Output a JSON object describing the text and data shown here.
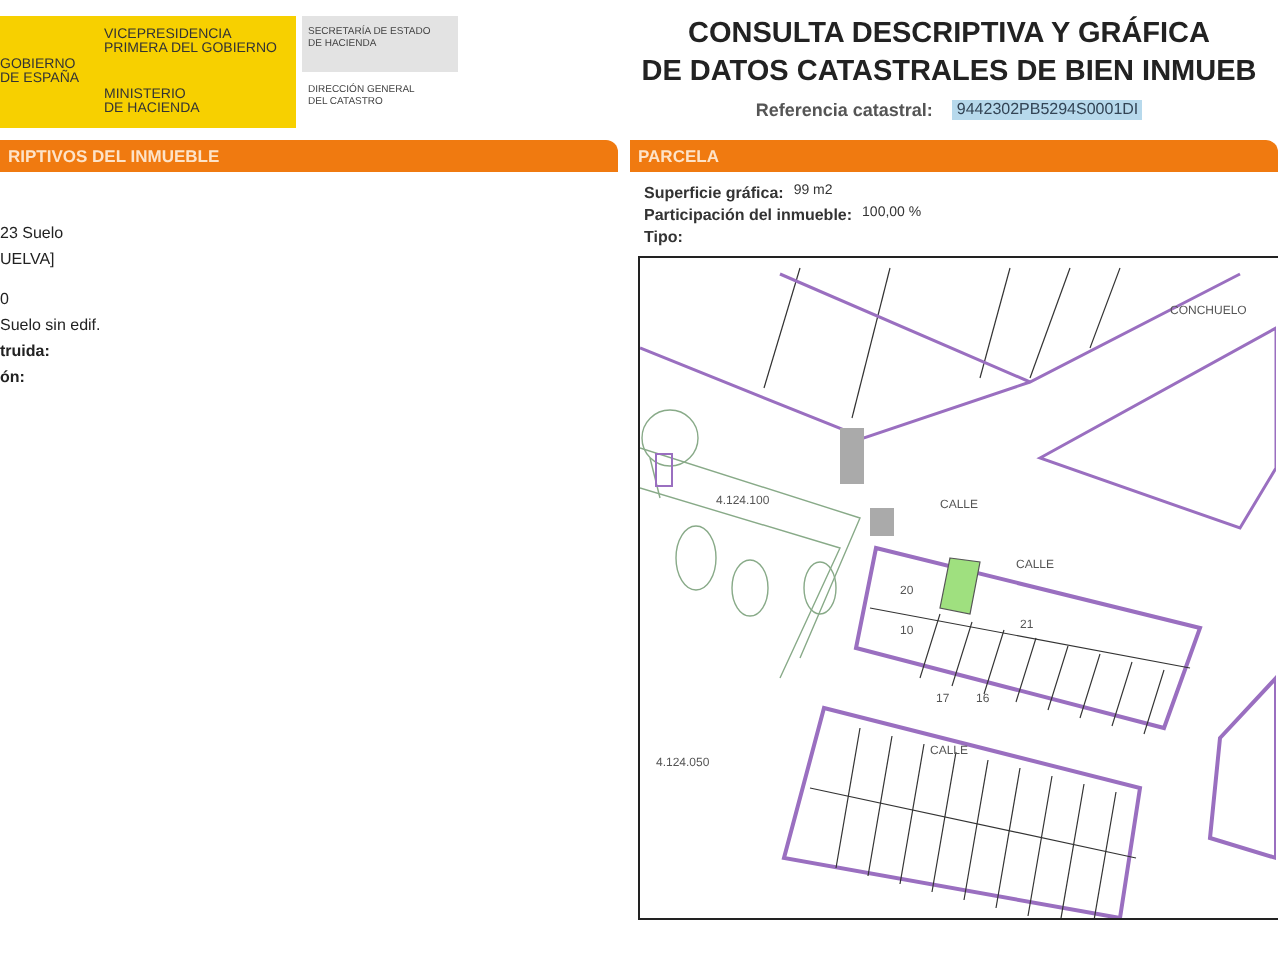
{
  "header": {
    "gov_lines": [
      "GOBIERNO",
      "DE ESPAÑA"
    ],
    "vice_lines": [
      "VICEPRESIDENCIA",
      "PRIMERA DEL GOBIERNO"
    ],
    "ministry_lines": [
      "MINISTERIO",
      "DE HACIENDA"
    ],
    "secretary_lines": [
      "SECRETARÍA DE ESTADO",
      "DE HACIENDA"
    ],
    "direction_lines": [
      "DIRECCIÓN GENERAL",
      "DEL CATASTRO"
    ]
  },
  "title_lines": [
    "CONSULTA DESCRIPTIVA Y GRÁFICA",
    "DE DATOS CATASTRALES DE BIEN INMUEB"
  ],
  "reference": {
    "label": "Referencia catastral:",
    "value": "9442302PB5294S0001DI"
  },
  "left_panel": {
    "heading": "RIPTIVOS DEL INMUEBLE",
    "lines": [
      {
        "text": "23 Suelo",
        "bold": false
      },
      {
        "text": "UELVA]",
        "bold": false
      },
      {
        "text": "0",
        "bold": false
      },
      {
        "text": "Suelo sin edif.",
        "bold": false
      },
      {
        "text": "truida:",
        "bold": true
      },
      {
        "text": "ón:",
        "bold": true
      }
    ]
  },
  "parcel": {
    "heading": "PARCELA",
    "fields": [
      {
        "label": "Superficie gráfica:",
        "value": "99 m2"
      },
      {
        "label": "Participación del inmueble:",
        "value": "100,00 %"
      },
      {
        "label": "Tipo:"
      }
    ]
  },
  "map": {
    "labels": [
      "CALLE",
      "CONCHUELO",
      "CALLE",
      "21",
      "20",
      "10",
      "17",
      "16",
      "CALLE",
      "4.124.100",
      "4.124.050"
    ]
  }
}
